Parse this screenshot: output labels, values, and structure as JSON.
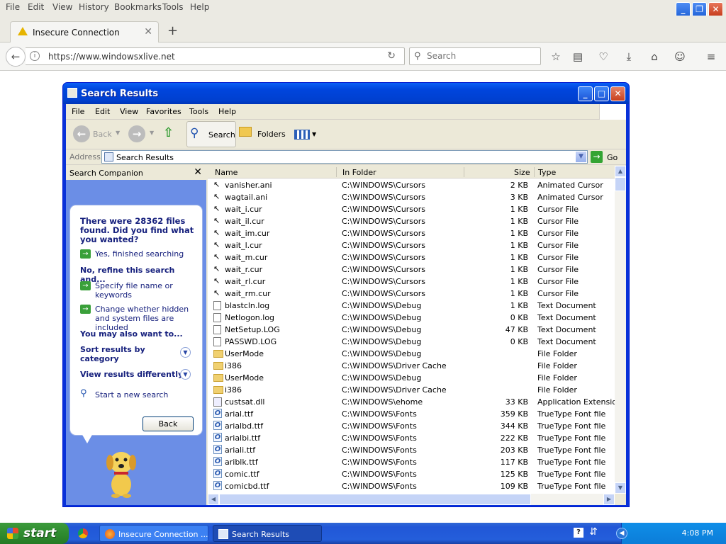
{
  "firefox": {
    "menu": [
      "File",
      "Edit",
      "View",
      "History",
      "Bookmarks",
      "Tools",
      "Help"
    ],
    "tab_title": "Insecure Connection",
    "url": "https://www.windowsxlive.net",
    "search_placeholder": "Search"
  },
  "window": {
    "title": "Search Results",
    "menu": [
      "File",
      "Edit",
      "View",
      "Favorites",
      "Tools",
      "Help"
    ],
    "toolbar": {
      "back": "Back",
      "search": "Search",
      "folders": "Folders"
    },
    "address_label": "Address",
    "address_value": "Search Results",
    "go_label": "Go"
  },
  "companion": {
    "title": "Search Companion",
    "question": "There were 28362 files found. Did you find what you wanted?",
    "yes": "Yes, finished searching",
    "refine_header": "No, refine this search and...",
    "refine1": "Specify file name or keywords",
    "refine2": "Change whether hidden and system files are included",
    "also": "You may also want to...",
    "sort": "Sort results by category",
    "view": "View results differently",
    "new_search": "Start a new search",
    "back": "Back"
  },
  "columns": [
    "Name",
    "In Folder",
    "Size",
    "Type"
  ],
  "rows": [
    {
      "icon": "cursor",
      "name": "vanisher.ani",
      "folder": "C:\\WINDOWS\\Cursors",
      "size": "2 KB",
      "type": "Animated Cursor"
    },
    {
      "icon": "cursor",
      "name": "wagtail.ani",
      "folder": "C:\\WINDOWS\\Cursors",
      "size": "3 KB",
      "type": "Animated Cursor"
    },
    {
      "icon": "cursor",
      "name": "wait_i.cur",
      "folder": "C:\\WINDOWS\\Cursors",
      "size": "1 KB",
      "type": "Cursor File"
    },
    {
      "icon": "cursor",
      "name": "wait_il.cur",
      "folder": "C:\\WINDOWS\\Cursors",
      "size": "1 KB",
      "type": "Cursor File"
    },
    {
      "icon": "cursor",
      "name": "wait_im.cur",
      "folder": "C:\\WINDOWS\\Cursors",
      "size": "1 KB",
      "type": "Cursor File"
    },
    {
      "icon": "cursor",
      "name": "wait_l.cur",
      "folder": "C:\\WINDOWS\\Cursors",
      "size": "1 KB",
      "type": "Cursor File"
    },
    {
      "icon": "cursor",
      "name": "wait_m.cur",
      "folder": "C:\\WINDOWS\\Cursors",
      "size": "1 KB",
      "type": "Cursor File"
    },
    {
      "icon": "cursor",
      "name": "wait_r.cur",
      "folder": "C:\\WINDOWS\\Cursors",
      "size": "1 KB",
      "type": "Cursor File"
    },
    {
      "icon": "cursor",
      "name": "wait_rl.cur",
      "folder": "C:\\WINDOWS\\Cursors",
      "size": "1 KB",
      "type": "Cursor File"
    },
    {
      "icon": "cursor",
      "name": "wait_rm.cur",
      "folder": "C:\\WINDOWS\\Cursors",
      "size": "1 KB",
      "type": "Cursor File"
    },
    {
      "icon": "doc",
      "name": "blastcln.log",
      "folder": "C:\\WINDOWS\\Debug",
      "size": "1 KB",
      "type": "Text Document"
    },
    {
      "icon": "doc",
      "name": "Netlogon.log",
      "folder": "C:\\WINDOWS\\Debug",
      "size": "0 KB",
      "type": "Text Document"
    },
    {
      "icon": "doc",
      "name": "NetSetup.LOG",
      "folder": "C:\\WINDOWS\\Debug",
      "size": "47 KB",
      "type": "Text Document"
    },
    {
      "icon": "doc",
      "name": "PASSWD.LOG",
      "folder": "C:\\WINDOWS\\Debug",
      "size": "0 KB",
      "type": "Text Document"
    },
    {
      "icon": "folder",
      "name": "UserMode",
      "folder": "C:\\WINDOWS\\Debug",
      "size": "",
      "type": "File Folder"
    },
    {
      "icon": "folder",
      "name": "i386",
      "folder": "C:\\WINDOWS\\Driver Cache",
      "size": "",
      "type": "File Folder"
    },
    {
      "icon": "folder",
      "name": "UserMode",
      "folder": "C:\\WINDOWS\\Debug",
      "size": "",
      "type": "File Folder"
    },
    {
      "icon": "folder",
      "name": "i386",
      "folder": "C:\\WINDOWS\\Driver Cache",
      "size": "",
      "type": "File Folder"
    },
    {
      "icon": "dll",
      "name": "custsat.dll",
      "folder": "C:\\WINDOWS\\ehome",
      "size": "33 KB",
      "type": "Application Extension"
    },
    {
      "icon": "font",
      "name": "arial.ttf",
      "folder": "C:\\WINDOWS\\Fonts",
      "size": "359 KB",
      "type": "TrueType Font file"
    },
    {
      "icon": "font",
      "name": "arialbd.ttf",
      "folder": "C:\\WINDOWS\\Fonts",
      "size": "344 KB",
      "type": "TrueType Font file"
    },
    {
      "icon": "font",
      "name": "arialbi.ttf",
      "folder": "C:\\WINDOWS\\Fonts",
      "size": "222 KB",
      "type": "TrueType Font file"
    },
    {
      "icon": "font",
      "name": "ariali.ttf",
      "folder": "C:\\WINDOWS\\Fonts",
      "size": "203 KB",
      "type": "TrueType Font file"
    },
    {
      "icon": "font",
      "name": "ariblk.ttf",
      "folder": "C:\\WINDOWS\\Fonts",
      "size": "117 KB",
      "type": "TrueType Font file"
    },
    {
      "icon": "font",
      "name": "comic.ttf",
      "folder": "C:\\WINDOWS\\Fonts",
      "size": "125 KB",
      "type": "TrueType Font file"
    },
    {
      "icon": "font",
      "name": "comicbd.ttf",
      "folder": "C:\\WINDOWS\\Fonts",
      "size": "109 KB",
      "type": "TrueType Font file"
    }
  ],
  "taskbar": {
    "start": "start",
    "tasks": [
      "Insecure Connection ...",
      "Search Results"
    ],
    "clock": "4:08 PM"
  }
}
